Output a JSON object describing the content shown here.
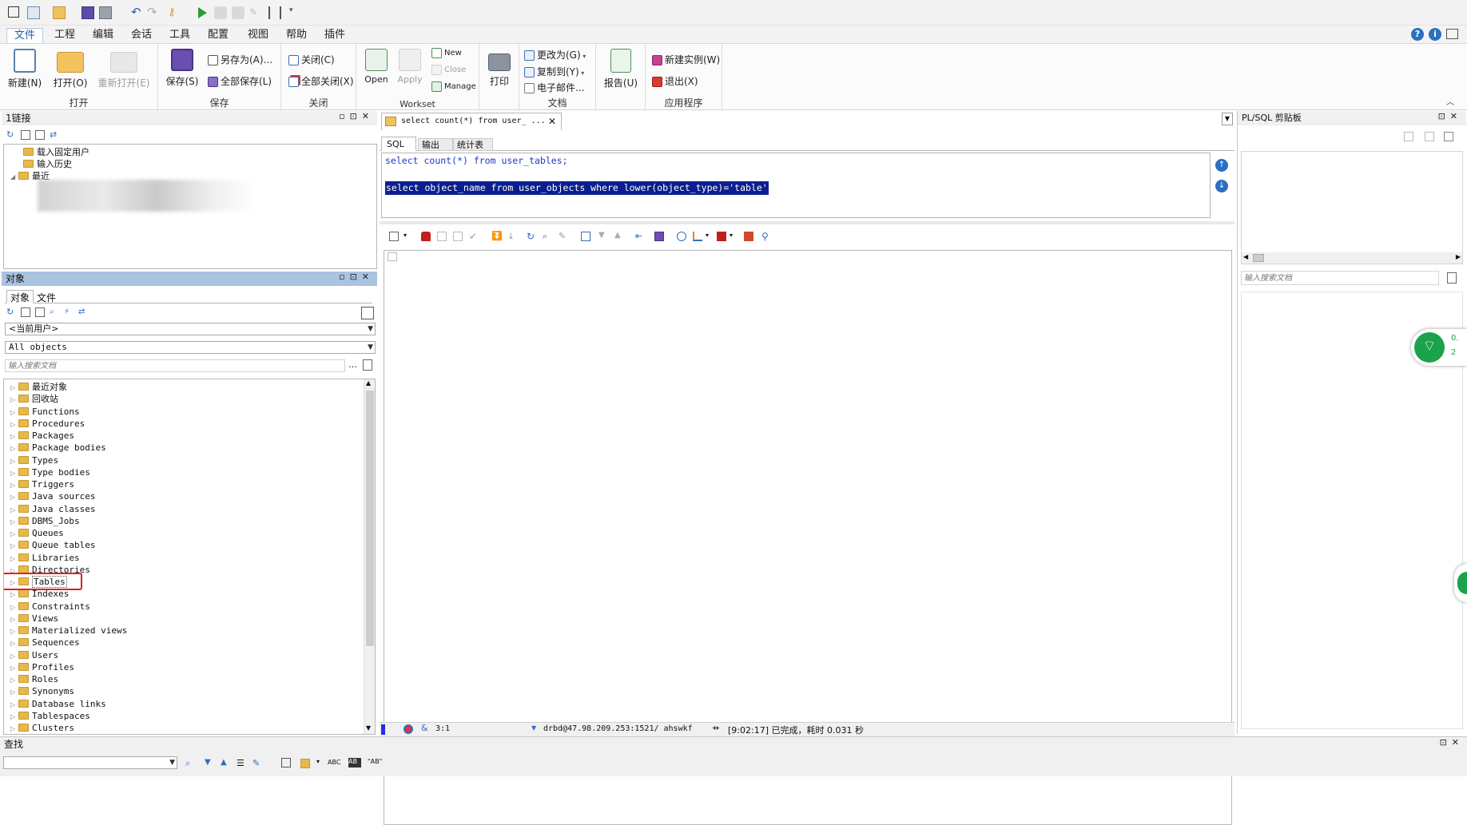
{
  "ribbon_tabs": [
    "文件",
    "工程",
    "编辑",
    "会话",
    "工具",
    "配置",
    "视图",
    "帮助",
    "插件"
  ],
  "ribbon": {
    "open_group": {
      "label": "打开",
      "new": "新建(N)",
      "open": "打开(O)",
      "reopen": "重新打开(E)"
    },
    "save_group": {
      "label": "保存",
      "save": "保存(S)",
      "save_as": "另存为(A)...",
      "save_all": "全部保存(L)"
    },
    "close_group": {
      "label": "关闭",
      "close": "关闭(C)",
      "close_all": "全部关闭(X)"
    },
    "workset_group": {
      "label": "Workset",
      "open": "Open",
      "apply": "Apply",
      "new": "New",
      "close": "Close",
      "manage": "Manage"
    },
    "print_group": {
      "print": "打印"
    },
    "doc_group": {
      "label": "文档",
      "change_to": "更改为(G)",
      "copy_to": "复制到(Y)",
      "email": "电子邮件..."
    },
    "report_group": {
      "report": "报告(U)"
    },
    "app_group": {
      "label": "应用程序",
      "new_instance": "新建实例(W)",
      "exit": "退出(X)"
    }
  },
  "connection_panel": {
    "title": "1链接",
    "items": [
      "载入固定用户",
      "输入历史",
      "最近"
    ]
  },
  "objects_panel": {
    "title": "对象",
    "tabs": [
      "对象",
      "文件"
    ],
    "user_select": "<当前用户>",
    "type_select": "All objects",
    "search_placeholder": "输入搜索文档",
    "tree": [
      "最近对象",
      "回收站",
      "Functions",
      "Procedures",
      "Packages",
      "Package bodies",
      "Types",
      "Type bodies",
      "Triggers",
      "Java sources",
      "Java classes",
      "DBMS_Jobs",
      "Queues",
      "Queue tables",
      "Libraries",
      "Directories",
      "Tables",
      "Indexes",
      "Constraints",
      "Views",
      "Materialized views",
      "Sequences",
      "Users",
      "Profiles",
      "Roles",
      "Synonyms",
      "Database links",
      "Tablespaces",
      "Clusters"
    ],
    "highlighted": "Tables"
  },
  "editor": {
    "tab_title": "select count(*) from user_ ...",
    "sub_tabs": [
      "SQL",
      "输出",
      "统计表"
    ],
    "line1_kw1": "select",
    "line1_fn": "count(*)",
    "line1_kw2": "from",
    "line1_rest": "user_tables;",
    "line2": "select object_name from user_objects where lower(object_type)='table'"
  },
  "statusbar": {
    "position": "3:1",
    "connection": "drbd@47.98.209.253:1521/ ahswkf",
    "message": "[9:02:17]  已完成，耗时 0.031 秒"
  },
  "clipboard_panel": {
    "title": "PL/SQL 剪贴板",
    "search_placeholder": "输入搜索文档"
  },
  "widget": {
    "line1": "0.",
    "line2": "2"
  },
  "find_panel": {
    "title": "查找"
  },
  "colors": {
    "accent": "#1a5fa8",
    "selection": "#0a1f8f",
    "highlight_box": "#e02020"
  }
}
